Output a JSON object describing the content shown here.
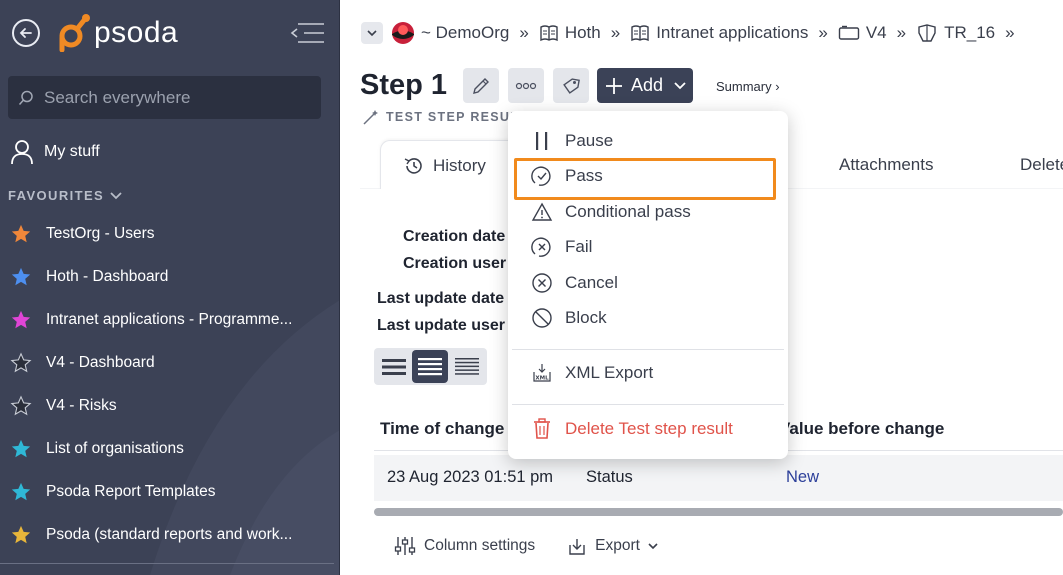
{
  "app": {
    "brand": "psoda"
  },
  "sidebar": {
    "search_placeholder": "Search everywhere",
    "my_stuff_label": "My stuff",
    "favourites_header": "FAVOURITES",
    "favourites": [
      {
        "label": "TestOrg - Users",
        "star_color": "#f0873a"
      },
      {
        "label": "Hoth - Dashboard",
        "star_color": "#4d8ff0"
      },
      {
        "label": "Intranet applications - Programme...",
        "star_color": "#e045d6"
      },
      {
        "label": "V4 - Dashboard",
        "star_color": "#2a2e3a"
      },
      {
        "label": "V4 - Risks",
        "star_color": "#2a2e3a"
      },
      {
        "label": "List of organisations",
        "star_color": "#2fb8d6"
      },
      {
        "label": "Psoda Report Templates",
        "star_color": "#2fb8d6"
      },
      {
        "label": "Psoda (standard reports and work...",
        "star_color": "#e8b63a"
      }
    ]
  },
  "breadcrumb": {
    "items": [
      {
        "label": "~ DemoOrg",
        "icon": "org-logo-icon"
      },
      {
        "label": "Hoth",
        "icon": "book-icon"
      },
      {
        "label": "Intranet applications",
        "icon": "book-icon"
      },
      {
        "label": "V4",
        "icon": "folder-icon"
      },
      {
        "label": "TR_16",
        "icon": "test-run-icon"
      }
    ],
    "separator": "»"
  },
  "header": {
    "title": "Step 1",
    "subtitle": "TEST STEP RESULT",
    "add_label": "Add",
    "summary_label": "Summary ›"
  },
  "tabs": [
    {
      "label": "History",
      "active": true
    },
    {
      "label": "Attachments"
    },
    {
      "label": "Delete"
    }
  ],
  "meta": {
    "creation_date_label": "Creation date",
    "creation_user_label": "Creation user",
    "last_update_date_label": "Last update date",
    "last_update_user_label": "Last update user"
  },
  "table": {
    "columns": [
      "Time of change",
      "Value before change"
    ],
    "rows": [
      {
        "time": "23 Aug 2023 01:51 pm",
        "field": "Status",
        "value_before": "New"
      }
    ]
  },
  "footer_actions": {
    "column_settings": "Column settings",
    "export": "Export"
  },
  "menu": {
    "items": [
      {
        "label": "Pause",
        "icon": "pause-icon"
      },
      {
        "label": "Pass",
        "icon": "check-circle-icon",
        "highlighted": true
      },
      {
        "label": "Conditional pass",
        "icon": "warning-icon"
      },
      {
        "label": "Fail",
        "icon": "fail-icon"
      },
      {
        "label": "Cancel",
        "icon": "cancel-icon"
      },
      {
        "label": "Block",
        "icon": "block-icon"
      }
    ],
    "export_label": "XML Export",
    "delete_label": "Delete Test step result"
  },
  "colors": {
    "sidebar_bg": "#3c4256",
    "accent_dark": "#3b4257",
    "highlight": "#f18a1c",
    "danger": "#e0534a",
    "link": "#2c3f9a"
  }
}
